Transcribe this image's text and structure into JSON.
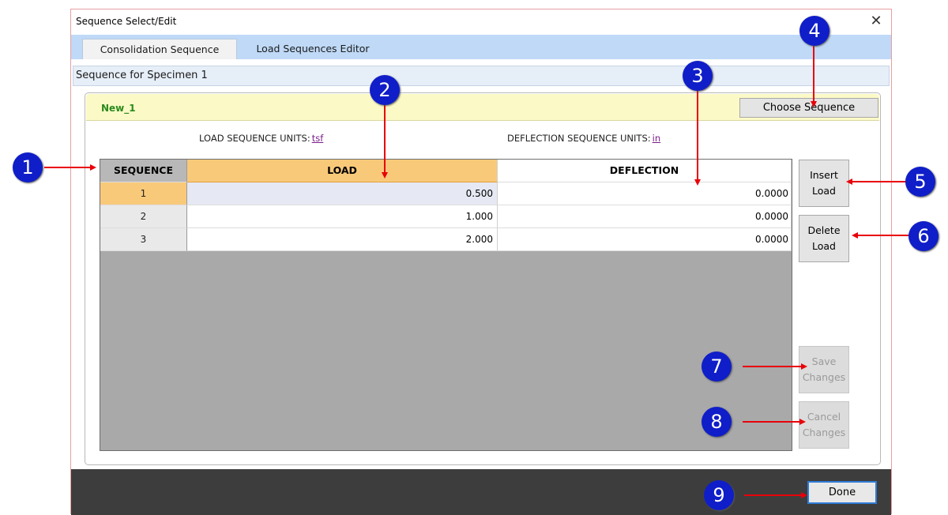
{
  "window": {
    "title": "Sequence Select/Edit",
    "close_glyph": "✕"
  },
  "tabs": [
    {
      "label": "Consolidation Sequence",
      "active": true
    },
    {
      "label": "Load Sequences Editor",
      "active": false
    }
  ],
  "subheader": "Sequence for Specimen 1",
  "group": {
    "sequence_name": "New_1",
    "choose_label": "Choose Sequence",
    "load_units_label": "LOAD SEQUENCE UNITS:",
    "load_units_value": "tsf",
    "defl_units_label": "DEFLECTION SEQUENCE UNITS:",
    "defl_units_value": "in"
  },
  "table": {
    "headers": [
      "SEQUENCE",
      "LOAD",
      "DEFLECTION"
    ],
    "rows": [
      [
        "1",
        "0.500",
        "0.0000"
      ],
      [
        "2",
        "1.000",
        "0.0000"
      ],
      [
        "3",
        "2.000",
        "0.0000"
      ]
    ]
  },
  "buttons": {
    "insert": [
      "Insert",
      "Load"
    ],
    "delete": [
      "Delete",
      "Load"
    ],
    "save": [
      "Save",
      "Changes"
    ],
    "cancel": [
      "Cancel",
      "Changes"
    ],
    "done": "Done"
  },
  "callouts": [
    "1",
    "2",
    "3",
    "4",
    "5",
    "6",
    "7",
    "8",
    "9"
  ],
  "colors": {
    "callout": "#0f1ec8",
    "arrow": "#e8000a",
    "header_highlight": "#f9c97a",
    "footer": "#3d3d3d",
    "done_border": "#2e7bd6"
  }
}
